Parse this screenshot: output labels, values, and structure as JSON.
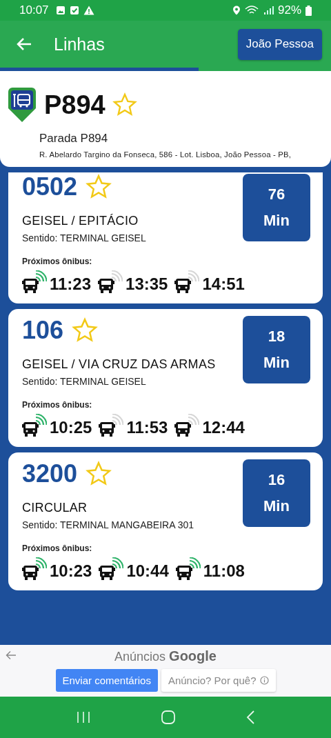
{
  "status_bar": {
    "time": "10:07",
    "battery": "92%"
  },
  "app_bar": {
    "title": "Linhas",
    "city_button": "João Pessoa"
  },
  "progress": {
    "level": 0.6
  },
  "stop": {
    "code": "P894",
    "favorite": false,
    "name": "Parada P894",
    "address": "R. Abelardo Targino da Fonseca, 586 - Lot. Lisboa, João Pessoa - PB,"
  },
  "lines": [
    {
      "number": "0502",
      "favorite": false,
      "eta": "76",
      "eta_unit": "Min",
      "route": "GEISEL / EPITÁCIO",
      "direction": "Sentido: TERMINAL GEISEL",
      "next_label": "Próximos ônibus:",
      "buses": [
        {
          "time": "11:23",
          "live": true
        },
        {
          "time": "13:35",
          "live": false
        },
        {
          "time": "14:51",
          "live": false
        }
      ]
    },
    {
      "number": "106",
      "favorite": false,
      "eta": "18",
      "eta_unit": "Min",
      "route": "GEISEL / VIA CRUZ DAS ARMAS",
      "direction": "Sentido: TERMINAL GEISEL",
      "next_label": "Próximos ônibus:",
      "buses": [
        {
          "time": "10:25",
          "live": true
        },
        {
          "time": "11:53",
          "live": false
        },
        {
          "time": "12:44",
          "live": false
        }
      ]
    },
    {
      "number": "3200",
      "favorite": false,
      "eta": "16",
      "eta_unit": "Min",
      "route": "CIRCULAR",
      "direction": "Sentido: TERMINAL MANGABEIRA 301",
      "next_label": "Próximos ônibus:",
      "buses": [
        {
          "time": "10:23",
          "live": true
        },
        {
          "time": "10:44",
          "live": true
        },
        {
          "time": "11:08",
          "live": true
        }
      ]
    }
  ],
  "ad": {
    "label": "Anúncios",
    "brand": "Google",
    "buttons": [
      {
        "label": "Enviar comentários",
        "kind": "primary"
      },
      {
        "label": "Anúncio? Por quê?",
        "kind": "info"
      }
    ]
  }
}
